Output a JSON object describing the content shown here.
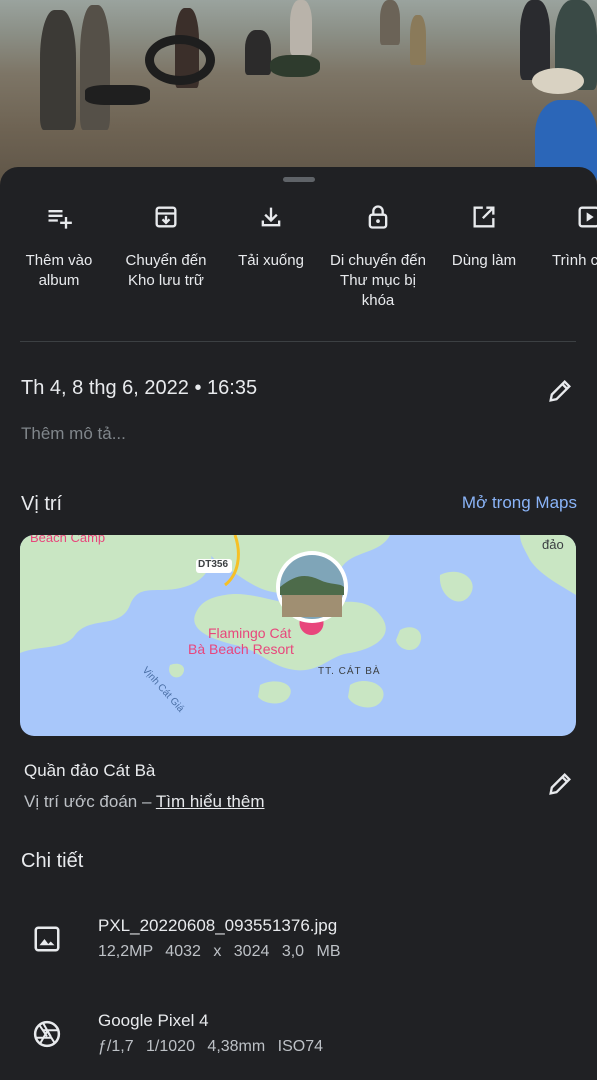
{
  "actions": [
    {
      "label": "Thêm vào album",
      "icon": "playlist-add-icon"
    },
    {
      "label": "Chuyển đến Kho lưu trữ",
      "icon": "archive-icon"
    },
    {
      "label": "Tải xuống",
      "icon": "download-icon"
    },
    {
      "label": "Di chuyển đến Thư mục bị khóa",
      "icon": "lock-icon"
    },
    {
      "label": "Dùng làm",
      "icon": "open-in-new-icon"
    },
    {
      "label": "Trình c",
      "icon": "slideshow-icon"
    }
  ],
  "date_text": "Th 4, 8 thg 6, 2022  •  16:35",
  "description_placeholder": "Thêm mô tả...",
  "location": {
    "title": "Vị trí",
    "open_in_maps": "Mở trong Maps",
    "place_name": "Quần đảo Cát Bà",
    "estimate_text": "Vị trí ước đoán – ",
    "learn_more": "Tìm hiểu thêm"
  },
  "map": {
    "label_camp": "Beach Camp",
    "label_road": "DT356",
    "label_resort_line1": "Flamingo Cát",
    "label_resort_line2": "Bà Beach Resort",
    "label_town": "TT. CÁT BÀ",
    "label_bay": "Vịnh Cát Giá",
    "label_island": "đảo"
  },
  "details": {
    "title": "Chi tiết",
    "file_name": "PXL_20220608_093551376.jpg",
    "file_info": "12,2MP  4032 x 3024  3,0 MB",
    "camera_name": "Google Pixel 4",
    "camera_info": "ƒ/1,7  1/1020  4,38mm  ISO74"
  },
  "colors": {
    "background": "#202124",
    "accent_link": "#8ab4f8",
    "map_water": "#a8c7fa",
    "map_land": "#c9e6c3"
  }
}
